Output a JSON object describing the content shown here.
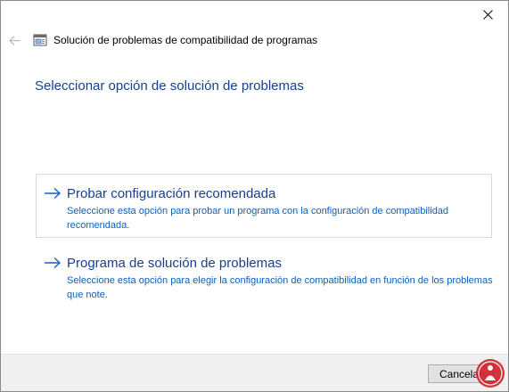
{
  "window": {
    "title": "Solución de problemas de compatibilidad de programas",
    "back_icon": "back-arrow-icon",
    "close_icon": "close-icon",
    "app_icon": "compatibility-troubleshooter-icon"
  },
  "page": {
    "heading": "Seleccionar opción de solución de problemas"
  },
  "options": [
    {
      "title": "Probar configuración recomendada",
      "description": "Seleccione esta opción para probar un programa con la configuración de compatibilidad recomendada.",
      "icon": "arrow-right-icon"
    },
    {
      "title": "Programa de solución de problemas",
      "description": "Seleccione esta opción para elegir la configuración de compatibilidad en función de los problemas que note.",
      "icon": "arrow-right-icon"
    }
  ],
  "footer": {
    "cancel_label": "Cancelar"
  },
  "colors": {
    "heading": "#1a3e8f",
    "link": "#0a5fbf",
    "footer_bg": "#f0f0f0",
    "highlight_border": "#cfdcea"
  }
}
